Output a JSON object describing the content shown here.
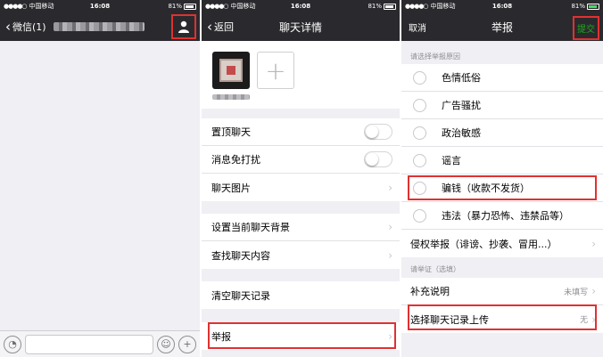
{
  "status": {
    "carrier": "中国移动",
    "signal": "●●●●○",
    "time": "16:08",
    "battery": "81%"
  },
  "panel1": {
    "back_label": "微信(1)",
    "profile_icon": "person-icon",
    "voice_icon": "voice-icon",
    "emoji_icon": "emoji-icon",
    "plus_icon": "plus-icon"
  },
  "panel2": {
    "back_label": "返回",
    "title": "聊天详情",
    "add_icon": "+",
    "rows": {
      "pin": "置顶聊天",
      "mute": "消息免打扰",
      "images": "聊天图片",
      "background": "设置当前聊天背景",
      "search": "查找聊天内容",
      "clear": "清空聊天记录",
      "report": "举报"
    }
  },
  "panel3": {
    "cancel": "取消",
    "title": "举报",
    "submit": "提交",
    "reason_header": "请选择举报原因",
    "reasons": [
      "色情低俗",
      "广告骚扰",
      "政治敏感",
      "谣言",
      "骗钱（收款不发货）",
      "违法（暴力恐怖、违禁品等）"
    ],
    "infringement": "侵权举报（诽谤、抄袭、冒用...）",
    "evidence_header": "请举证（选填）",
    "supplement": "补充说明",
    "supplement_value": "未填写",
    "upload": "选择聊天记录上传",
    "upload_value": "无"
  },
  "colors": {
    "bar": "#2a2a2e",
    "highlight": "#e03131",
    "submit": "#1aad19"
  }
}
